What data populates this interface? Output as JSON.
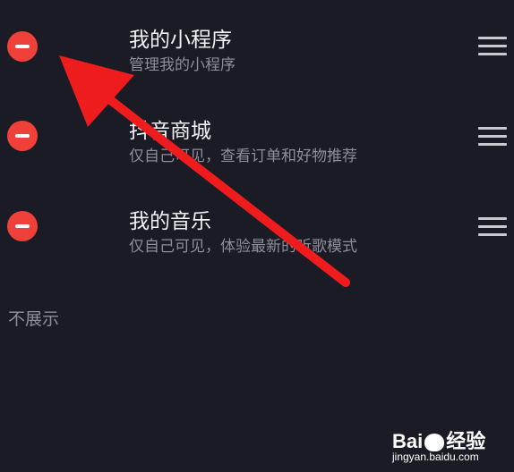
{
  "items": [
    {
      "title": "我的小程序",
      "subtitle": "管理我的小程序"
    },
    {
      "title": "抖音商城",
      "subtitle": "仅自己可见，查看订单和好物推荐"
    },
    {
      "title": "我的音乐",
      "subtitle": "仅自己可见，体验最新的听歌模式"
    }
  ],
  "section_label": "不展示",
  "watermark": {
    "logo_prefix": "Bai",
    "logo_suffix": "经验",
    "url": "jingyan.baidu.com"
  },
  "colors": {
    "background": "#1b1b26",
    "remove_button": "#f0403a",
    "annotation_arrow": "#ee1c1c"
  },
  "icons": [
    "remove-icon",
    "drag-handle-icon",
    "annotation-arrow"
  ]
}
